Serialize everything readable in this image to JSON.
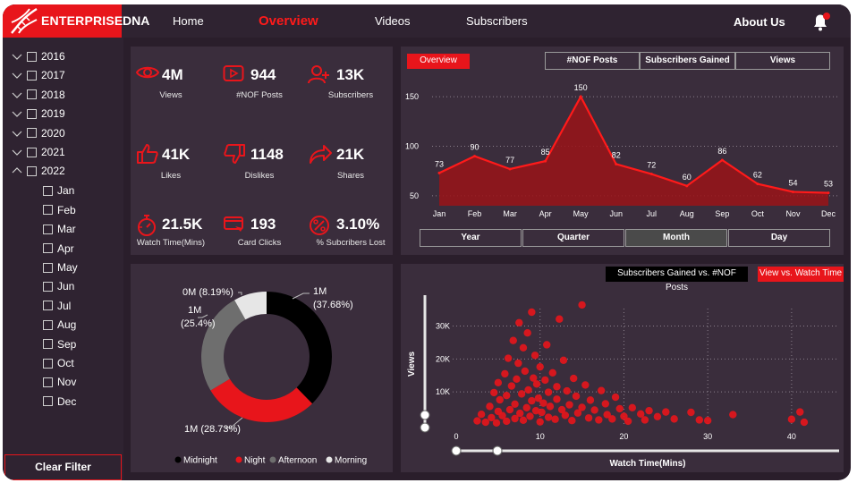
{
  "header": {
    "brand": "ENTERPRISE",
    "brand_suffix": "DNA",
    "nav": [
      "Home",
      "Overview",
      "Videos",
      "Subscribers"
    ],
    "active_nav": "Overview",
    "about": "About Us"
  },
  "sidebar": {
    "years": [
      "2016",
      "2017",
      "2018",
      "2019",
      "2020",
      "2021",
      "2022"
    ],
    "months": [
      "Jan",
      "Feb",
      "Mar",
      "Apr",
      "May",
      "Jun",
      "Jul",
      "Aug",
      "Sep",
      "Oct",
      "Nov",
      "Dec"
    ],
    "clear_filter": "Clear Filter"
  },
  "kpis": [
    {
      "value": "4M",
      "label": "Views",
      "icon": "eye-icon"
    },
    {
      "value": "944",
      "label": "#NOF Posts",
      "icon": "play-icon"
    },
    {
      "value": "13K",
      "label": "Subscribers",
      "icon": "user-add-icon"
    },
    {
      "value": "41K",
      "label": "Likes",
      "icon": "thumbs-up-icon"
    },
    {
      "value": "1148",
      "label": "Dislikes",
      "icon": "thumbs-down-icon"
    },
    {
      "value": "21K",
      "label": "Shares",
      "icon": "share-icon"
    },
    {
      "value": "21.5K",
      "label": "Watch Time(Mins)",
      "icon": "stopwatch-icon"
    },
    {
      "value": "193",
      "label": "Card Clicks",
      "icon": "card-icon"
    },
    {
      "value": "3.10%",
      "label": "% Subcribers Lost",
      "icon": "percent-icon"
    }
  ],
  "area_panel": {
    "overview_tag": "Overview",
    "metric_buttons": [
      "#NOF Posts",
      "Subscribers Gained",
      "Views"
    ],
    "period_buttons": [
      "Year",
      "Quarter",
      "Month",
      "Day"
    ],
    "selected_period": "Month"
  },
  "donut_panel": {
    "labels": [
      "1M\n(37.68%)",
      "1M (28.73%)",
      "1M\n(25.4%)",
      "0M (8.19%)"
    ]
  },
  "scatter_panel": {
    "tag_black": "Subscribers Gained vs. #NOF Posts",
    "tag_red": "View vs. Watch Time"
  },
  "colors": {
    "accent": "#e8151b",
    "panel": "#3a2d3c",
    "background": "#2a1e2b"
  },
  "chart_data": [
    {
      "type": "area",
      "categories": [
        "Jan",
        "Feb",
        "Mar",
        "Apr",
        "May",
        "Jun",
        "Jul",
        "Aug",
        "Sep",
        "Oct",
        "Nov",
        "Dec"
      ],
      "values": [
        73,
        90,
        77,
        85,
        150,
        82,
        72,
        60,
        86,
        62,
        54,
        53
      ],
      "ylim": [
        40,
        160
      ],
      "yticks": [
        50,
        100,
        150
      ],
      "grid": true
    },
    {
      "type": "pie",
      "donut": true,
      "labels": [
        "Midnight",
        "Night",
        "Afternoon",
        "Morning"
      ],
      "values": [
        37.68,
        28.73,
        25.4,
        8.19
      ],
      "colors": [
        "#000000",
        "#e8151b",
        "#6e6e6e",
        "#e6e6e6"
      ],
      "legend": "bottom"
    },
    {
      "type": "scatter",
      "xlabel": "Watch Time(Mins)",
      "ylabel": "Views",
      "xticks": [
        0,
        10,
        20,
        30,
        40
      ],
      "yticks": [
        "10K",
        "20K",
        "30K"
      ],
      "xlim": [
        0,
        43
      ],
      "ylim": [
        0,
        38000
      ],
      "points": [
        [
          2.5,
          1200
        ],
        [
          3,
          3200
        ],
        [
          3.5,
          800
        ],
        [
          4,
          5600
        ],
        [
          4.2,
          2200
        ],
        [
          4.5,
          9800
        ],
        [
          4.8,
          600
        ],
        [
          5,
          4100
        ],
        [
          5,
          12800
        ],
        [
          5.2,
          7600
        ],
        [
          5.5,
          2800
        ],
        [
          5.8,
          15500
        ],
        [
          6,
          1100
        ],
        [
          6,
          8900
        ],
        [
          6.2,
          20200
        ],
        [
          6.4,
          4600
        ],
        [
          6.6,
          11800
        ],
        [
          6.8,
          25600
        ],
        [
          7,
          1900
        ],
        [
          7,
          6300
        ],
        [
          7.2,
          13900
        ],
        [
          7.4,
          18700
        ],
        [
          7.5,
          31000
        ],
        [
          7.6,
          3500
        ],
        [
          7.8,
          9400
        ],
        [
          8,
          23400
        ],
        [
          8,
          1400
        ],
        [
          8.2,
          16300
        ],
        [
          8.4,
          5200
        ],
        [
          8.5,
          27900
        ],
        [
          8.6,
          10600
        ],
        [
          8.8,
          2600
        ],
        [
          9,
          7300
        ],
        [
          9,
          34200
        ],
        [
          9.2,
          14200
        ],
        [
          9.4,
          21100
        ],
        [
          9.5,
          4300
        ],
        [
          9.6,
          12400
        ],
        [
          9.8,
          8100
        ],
        [
          10,
          900
        ],
        [
          10,
          17600
        ],
        [
          10.2,
          3800
        ],
        [
          10.4,
          6600
        ],
        [
          10.6,
          13600
        ],
        [
          10.8,
          24300
        ],
        [
          11,
          2300
        ],
        [
          11,
          9900
        ],
        [
          11.2,
          5600
        ],
        [
          11.5,
          15800
        ],
        [
          11.8,
          1700
        ],
        [
          12,
          11600
        ],
        [
          12,
          7800
        ],
        [
          12.3,
          32100
        ],
        [
          12.6,
          4600
        ],
        [
          12.8,
          19600
        ],
        [
          13,
          2900
        ],
        [
          13.2,
          10300
        ],
        [
          13.5,
          6100
        ],
        [
          13.8,
          1300
        ],
        [
          14,
          14100
        ],
        [
          14.3,
          8700
        ],
        [
          14.5,
          3600
        ],
        [
          15,
          36400
        ],
        [
          15,
          5300
        ],
        [
          15.4,
          12100
        ],
        [
          15.8,
          2100
        ],
        [
          16,
          7500
        ],
        [
          16.5,
          4500
        ],
        [
          17,
          1500
        ],
        [
          17.3,
          10400
        ],
        [
          17.8,
          6400
        ],
        [
          18,
          3100
        ],
        [
          18.6,
          1800
        ],
        [
          19,
          8400
        ],
        [
          19.5,
          4900
        ],
        [
          20,
          2600
        ],
        [
          20.5,
          1100
        ],
        [
          21,
          5200
        ],
        [
          22,
          3300
        ],
        [
          22.5,
          1500
        ],
        [
          23,
          4300
        ],
        [
          24,
          2500
        ],
        [
          25,
          3900
        ],
        [
          26,
          1800
        ],
        [
          28,
          3800
        ],
        [
          29,
          1500
        ],
        [
          30,
          1300
        ],
        [
          33,
          3100
        ],
        [
          40,
          1700
        ],
        [
          41,
          3900
        ],
        [
          41.5,
          800
        ]
      ]
    }
  ]
}
